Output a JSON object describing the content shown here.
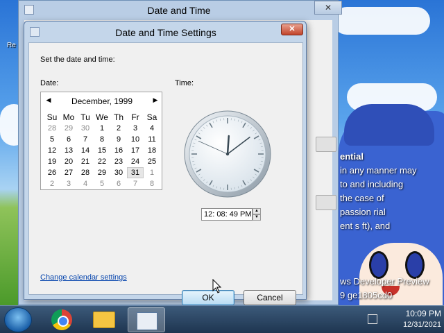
{
  "desktop": {
    "label": "Re",
    "overlay_lines": [
      "ential",
      "in any manner may",
      "to and including",
      "the case of",
      "passion rial",
      "ent s ft), and",
      "ws Developer Preview",
      "9 ge1805cd0"
    ]
  },
  "back_window": {
    "title": "Date and Time",
    "close_label": "✕"
  },
  "dialog": {
    "title": "Date and Time Settings",
    "close_label": "✕",
    "instruction": "Set the date and time:",
    "date_label": "Date:",
    "time_label": "Time:",
    "calendar": {
      "month_label": "December, 1999",
      "prev_label": "◀",
      "next_label": "▶",
      "weekdays": [
        "Su",
        "Mo",
        "Tu",
        "We",
        "Th",
        "Fr",
        "Sa"
      ],
      "weeks": [
        [
          {
            "d": "28",
            "o": true
          },
          {
            "d": "29",
            "o": true
          },
          {
            "d": "30",
            "o": true
          },
          {
            "d": "1"
          },
          {
            "d": "2"
          },
          {
            "d": "3"
          },
          {
            "d": "4"
          }
        ],
        [
          {
            "d": "5"
          },
          {
            "d": "6"
          },
          {
            "d": "7"
          },
          {
            "d": "8"
          },
          {
            "d": "9"
          },
          {
            "d": "10"
          },
          {
            "d": "11"
          }
        ],
        [
          {
            "d": "12"
          },
          {
            "d": "13"
          },
          {
            "d": "14"
          },
          {
            "d": "15"
          },
          {
            "d": "16"
          },
          {
            "d": "17"
          },
          {
            "d": "18"
          }
        ],
        [
          {
            "d": "19"
          },
          {
            "d": "20"
          },
          {
            "d": "21"
          },
          {
            "d": "22"
          },
          {
            "d": "23"
          },
          {
            "d": "24"
          },
          {
            "d": "25"
          }
        ],
        [
          {
            "d": "26"
          },
          {
            "d": "27"
          },
          {
            "d": "28"
          },
          {
            "d": "29"
          },
          {
            "d": "30"
          },
          {
            "d": "31",
            "s": true
          },
          {
            "d": "1",
            "o": true
          }
        ],
        [
          {
            "d": "2",
            "o": true
          },
          {
            "d": "3",
            "o": true
          },
          {
            "d": "4",
            "o": true
          },
          {
            "d": "5",
            "o": true
          },
          {
            "d": "6",
            "o": true
          },
          {
            "d": "7",
            "o": true
          },
          {
            "d": "8",
            "o": true
          }
        ]
      ]
    },
    "clock": {
      "hour": 12,
      "minute": 8,
      "second": 49
    },
    "time_value": "12: 08: 49 PM",
    "change_calendar_link": "Change calendar settings",
    "ok_label": "OK",
    "cancel_label": "Cancel"
  },
  "taskbar": {
    "time": "10:09 PM",
    "date": "12/31/2021",
    "pinned_icons": [
      "windows-start-icon",
      "chrome-icon",
      "file-explorer-icon",
      "date-time-icon"
    ]
  }
}
